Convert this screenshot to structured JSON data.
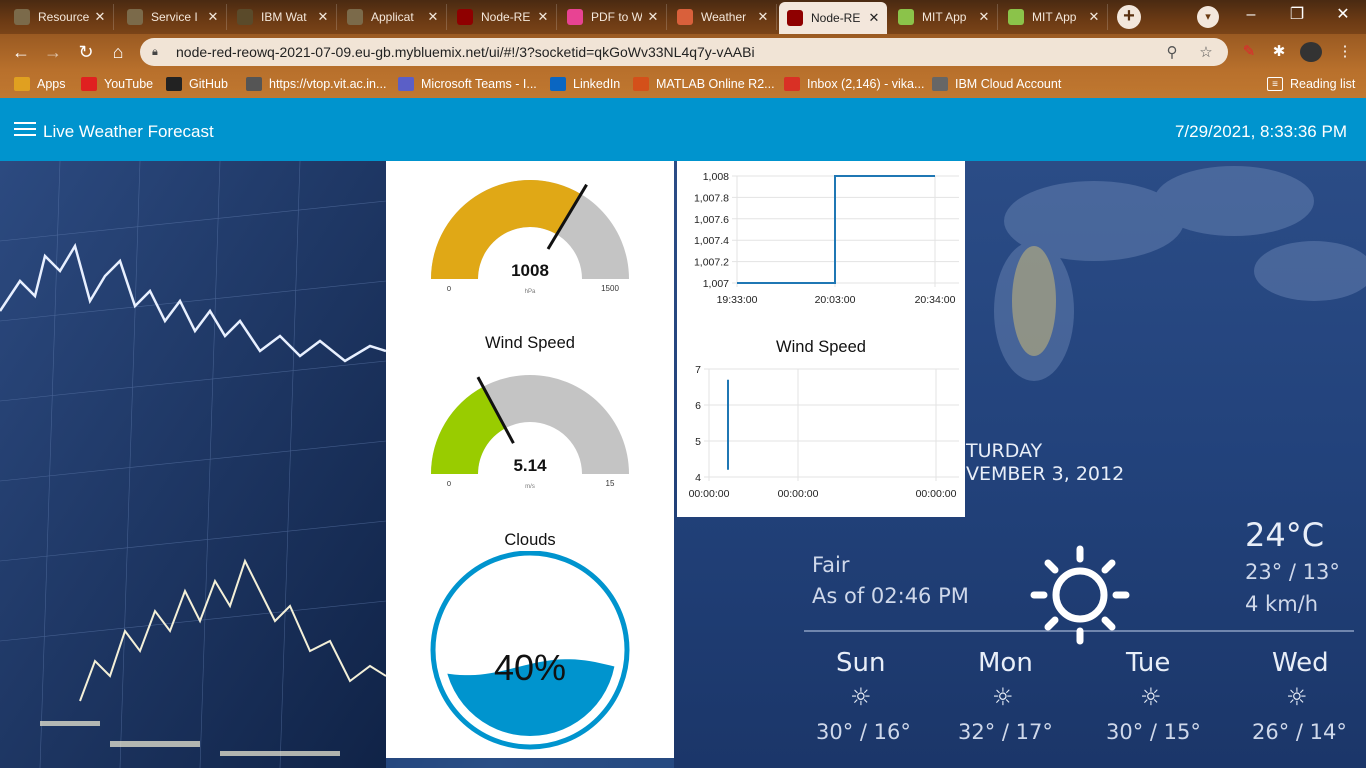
{
  "browser": {
    "tabs": [
      {
        "title": "Resource",
        "icon": "ibm-cloud-icon",
        "color": "#7b6a4a"
      },
      {
        "title": "Service I",
        "icon": "ibm-cloud-icon",
        "color": "#7b6a4a"
      },
      {
        "title": "IBM Wat",
        "icon": "watson-icon",
        "color": "#5a4a2a"
      },
      {
        "title": "Applicat",
        "icon": "ibm-cloud-icon",
        "color": "#7b6a4a"
      },
      {
        "title": "Node-RE",
        "icon": "node-red-icon",
        "color": "#8f0000"
      },
      {
        "title": "PDF to W",
        "icon": "pdf-converter-icon",
        "color": "#e84393"
      },
      {
        "title": "Weather",
        "icon": "weather-icon",
        "color": "#d9603b"
      },
      {
        "title": "Node-RE",
        "icon": "node-red-icon",
        "color": "#8f0000",
        "active": true
      },
      {
        "title": "MIT App",
        "icon": "mit-app-inventor-icon",
        "color": "#8bc34a"
      },
      {
        "title": "MIT App",
        "icon": "mit-app-inventor-icon",
        "color": "#8bc34a"
      }
    ],
    "new_tab_label": "+",
    "url": "node-red-reowq-2021-07-09.eu-gb.mybluemix.net/ui/#!/3?socketid=qkGoWv33NL4q7y-vAABi",
    "bookmarks": [
      {
        "label": "Apps",
        "icon": "apps-grid-icon"
      },
      {
        "label": "YouTube",
        "icon": "youtube-icon"
      },
      {
        "label": "GitHub",
        "icon": "github-icon"
      },
      {
        "label": "https://vtop.vit.ac.in...",
        "icon": "vtop-icon"
      },
      {
        "label": "Microsoft Teams - I...",
        "icon": "teams-icon"
      },
      {
        "label": "LinkedIn",
        "icon": "linkedin-icon"
      },
      {
        "label": "MATLAB Online R2...",
        "icon": "matlab-icon"
      },
      {
        "label": "Inbox (2,146) - vika...",
        "icon": "gmail-icon"
      },
      {
        "label": "IBM Cloud Account",
        "icon": "ibm-cloud-icon"
      }
    ],
    "reading_list": "Reading list"
  },
  "dashboard": {
    "title": "Live Weather Forecast",
    "datetime": "7/29/2021, 8:33:36 PM",
    "accent": "#0094ce",
    "pressure_gauge": {
      "value": "1008",
      "fraction": 0.672,
      "units": "hPa",
      "min": "0",
      "max": "1500",
      "color": "#e0a816"
    },
    "wind_gauge": {
      "title": "Wind Speed",
      "value": "5.14",
      "fraction": 0.343,
      "units": "m/s",
      "min": "0",
      "max": "15",
      "color": "#99cc00"
    },
    "clouds": {
      "title": "Clouds",
      "value": "40%",
      "fraction": 0.4,
      "color": "#0094ce"
    }
  },
  "chart_data": [
    {
      "type": "line",
      "title": "",
      "x_ticks": [
        "19:33:00",
        "20:03:00",
        "20:34:00"
      ],
      "y_ticks": [
        "1,007",
        "1,007.2",
        "1,007.4",
        "1,007.6",
        "1,007.8",
        "1,008"
      ],
      "ylim": [
        1007,
        1008
      ],
      "x": [
        "19:33:00",
        "20:03:00",
        "20:03:00",
        "20:34:00"
      ],
      "y": [
        1007,
        1007,
        1008,
        1008
      ],
      "color": "#1f77b4",
      "grid": true
    },
    {
      "type": "line",
      "title": "Wind Speed",
      "x_ticks": [
        "00:00:00",
        "00:00:00",
        "00:00:00"
      ],
      "y_ticks": [
        "4",
        "5",
        "6",
        "7"
      ],
      "ylim": [
        4,
        7
      ],
      "series": [
        {
          "values": [
            4.2,
            6.7,
            5.1
          ]
        }
      ],
      "color": "#1f77b4",
      "grid": true
    }
  ],
  "background": {
    "day": "TURDAY",
    "date": "VEMBER 3, 2012",
    "temp": "24°C",
    "condition": "Fair",
    "as_of": "As of 02:46 PM",
    "hi_lo": "23° / 13°",
    "wind": "4 km/h",
    "forecast": [
      {
        "day": "Sun",
        "temps": "30° / 16°"
      },
      {
        "day": "Mon",
        "temps": "32° / 17°"
      },
      {
        "day": "Tue",
        "temps": "30° / 15°"
      },
      {
        "day": "Wed",
        "temps": "26° / 14°"
      }
    ]
  }
}
